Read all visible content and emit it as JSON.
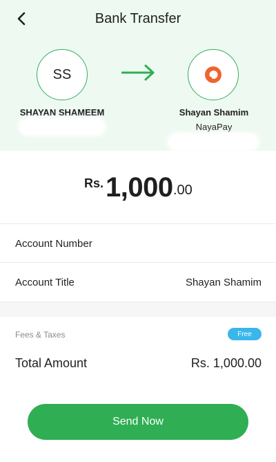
{
  "header": {
    "title": "Bank Transfer",
    "back_icon": "chevron-left-icon"
  },
  "sender": {
    "initials": "SS",
    "name": "SHAYAN SHAMEEM"
  },
  "receiver": {
    "name": "Shayan Shamim",
    "bank": "NayaPay",
    "logo_icon": "nayapay-logo-icon"
  },
  "amount": {
    "currency": "Rs.",
    "whole": "1,000",
    "decimal": ".00"
  },
  "details": {
    "account_number_label": "Account Number",
    "account_number_value": "",
    "account_title_label": "Account Title",
    "account_title_value": "Shayan Shamim"
  },
  "fees": {
    "label": "Fees & Taxes",
    "badge": "Free"
  },
  "total": {
    "label": "Total Amount",
    "value": "Rs. 1,000.00"
  },
  "actions": {
    "send_label": "Send Now"
  },
  "colors": {
    "accent_green": "#2fae54",
    "badge_blue": "#3ab6ea",
    "header_bg": "#eef9f1",
    "logo_orange": "#f0642e"
  }
}
